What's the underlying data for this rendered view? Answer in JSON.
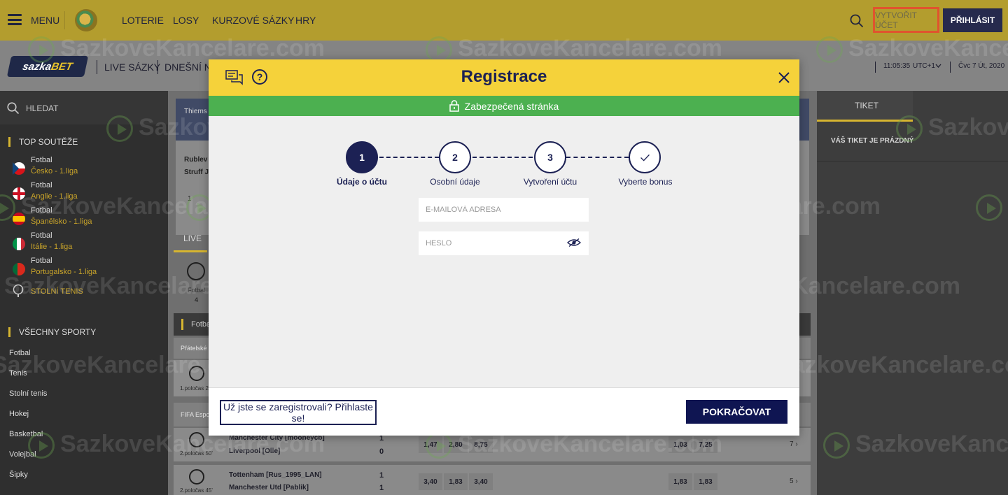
{
  "header": {
    "menu_label": "MENU",
    "nav": [
      "LOTERIE",
      "LOSY",
      "KURZOVÉ SÁZKY",
      "HRY"
    ],
    "create_account": "VYTVOŘIT ÚČET",
    "login": "PŘIHLÁSIT"
  },
  "subheader": {
    "logo_text_a": "sazka",
    "logo_text_b": "BET",
    "links": [
      "LIVE SÁZKY",
      "DNEŠNÍ NA"
    ],
    "time": "11:05:35",
    "timezone": "UTC+1",
    "date": "Čvc 7 Út, 2020"
  },
  "sidebar": {
    "search_label": "HLEDAT",
    "top_heading": "TOP SOUTĚŽE",
    "leagues": [
      {
        "sport": "Fotbal",
        "name": "Česko - 1.liga",
        "flag": "cz-flag-icon"
      },
      {
        "sport": "Fotbal",
        "name": "Anglie - 1.liga",
        "flag": "en-flag-icon"
      },
      {
        "sport": "Fotbal",
        "name": "Španělsko - 1.liga",
        "flag": "es-flag-icon"
      },
      {
        "sport": "Fotbal",
        "name": "Itálie - 1.liga",
        "flag": "it-flag-icon"
      },
      {
        "sport": "Fotbal",
        "name": "Portugalsko - 1.liga",
        "flag": "pt-flag-icon"
      }
    ],
    "table_tennis": "STOLNÍ TENIS",
    "all_heading": "VŠECHNY SPORTY",
    "sports": [
      "Fotbal",
      "Tenis",
      "Stolní tenis",
      "Hokej",
      "Basketbal",
      "Volejbal",
      "Šipky"
    ]
  },
  "center": {
    "card_player": "Thiems S",
    "card_p1": "Rublev A",
    "card_p2": "Struff Ja",
    "card_num": "1",
    "live_tab": "LIVE",
    "sport_tile_label": "Fotbal",
    "sport_tile_count": "4",
    "section_label": "Fotba",
    "group1": "Přátelské",
    "group1_period": "1.poločas 2",
    "group2": "FIFA Espo",
    "matches": [
      {
        "home": "Manchester City [mooneycb]",
        "away": "Liverpool [Olle]",
        "home_score": "1",
        "away_score": "0",
        "period": "2.poločas 50'",
        "odds": [
          "1,47",
          "2,80",
          "8,75"
        ],
        "odds2": [
          "1,03",
          "7,25"
        ],
        "more": "7"
      },
      {
        "home": "Tottenham [Rus_1995_LAN]",
        "away": "Manchester Utd [Pablik]",
        "home_score": "1",
        "away_score": "1",
        "period": "2.poločas 45'",
        "odds": [
          "3,40",
          "1,83",
          "3,40"
        ],
        "odds2": [
          "1,83",
          "1,83"
        ],
        "more": "5"
      }
    ]
  },
  "ticket": {
    "tab": "TIKET",
    "empty": "VÁŠ TIKET JE PRÁZDNÝ"
  },
  "watermark": "SazkoveKancelare.com",
  "modal": {
    "title": "Registrace",
    "secure_label": "Zabezpečená stránka",
    "steps": [
      {
        "num": "1",
        "label": "Údaje o účtu"
      },
      {
        "num": "2",
        "label": "Osobní údaje"
      },
      {
        "num": "3",
        "label": "Vytvoření účtu"
      },
      {
        "num": "",
        "label": "Vyberte bonus"
      }
    ],
    "email_placeholder": "E-MAILOVÁ ADRESA",
    "password_placeholder": "HESLO",
    "already_registered": "Už jste se zaregistrovali? Přihlaste se!",
    "continue": "POKRAČOVAT"
  },
  "colors": {
    "accent_yellow": "#f5d23a",
    "navy": "#1c2154",
    "secure_green": "#4cb050",
    "highlight_red": "#e0542e"
  }
}
